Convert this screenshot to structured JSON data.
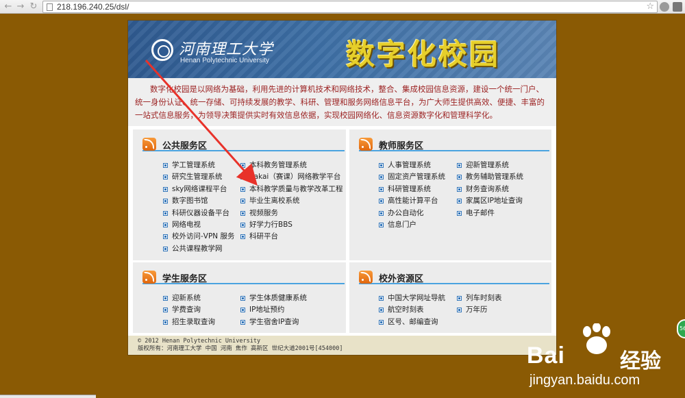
{
  "browser": {
    "url": "218.196.240.25/dsl/",
    "back_icon": "back-arrow-icon",
    "forward_icon": "forward-arrow-icon",
    "reload_icon": "reload-icon"
  },
  "banner": {
    "logo_cn": "河南理工大学",
    "logo_en": "Henan Polytechnic University",
    "title": "数字化校园"
  },
  "intro": "数字化校园是以网络为基础，利用先进的计算机技术和网络技术，整合、集成校园信息资源，建设一个统一门户、统一身份认证、统一存储、可持续发展的教学、科研、管理和服务网络信息平台，为广大师生提供高效、便捷、丰富的一站式信息服务，为领导决策提供实时有效信息依据，实现校园网络化、信息资源数字化和管理科学化。",
  "sections": {
    "public": {
      "title": "公共服务区",
      "col1": [
        "学工管理系统",
        "研究生管理系统",
        "sky网络课程平台",
        "数字图书馆",
        "科研仪器设备平台",
        "网络电视",
        "校外访问-VPN 服务",
        "公共课程教学网"
      ],
      "col2": [
        "本科教务管理系统",
        "Sakai（赛课）网络教学平台",
        "本科教学质量与教学改革工程",
        "毕业生离校系统",
        "视频服务",
        "好学力行BBS",
        "科研平台"
      ]
    },
    "teacher": {
      "title": "教师服务区",
      "col1": [
        "人事管理系统",
        "固定资产管理系统",
        "科研管理系统",
        "高性能计算平台",
        "办公自动化",
        "信息门户"
      ],
      "col2": [
        "迎新管理系统",
        "教务辅助管理系统",
        "财务查询系统",
        "家属区IP地址查询",
        "电子邮件"
      ]
    },
    "student": {
      "title": "学生服务区",
      "col1": [
        "迎新系统",
        "学费查询",
        "招生录取查询"
      ],
      "col2": [
        "学生体质健康系统",
        "IP地址预约",
        "学生宿舍IP查询"
      ]
    },
    "external": {
      "title": "校外资源区",
      "col1": [
        "中国大学网址导航",
        "航空时刻表",
        "区号、邮编查询"
      ],
      "col2": [
        "列车时刻表",
        "万年历"
      ]
    }
  },
  "footer": {
    "line1": "© 2012 Henan Polytechnic University",
    "line2": "版权所有：河南理工大学 中国 河南 焦作 高新区 世纪大道2001号[454000]"
  },
  "watermark": {
    "brand": "Bai",
    "brand_suffix": "经验",
    "url": "jingyan.baidu.com"
  },
  "side_badge": "56"
}
